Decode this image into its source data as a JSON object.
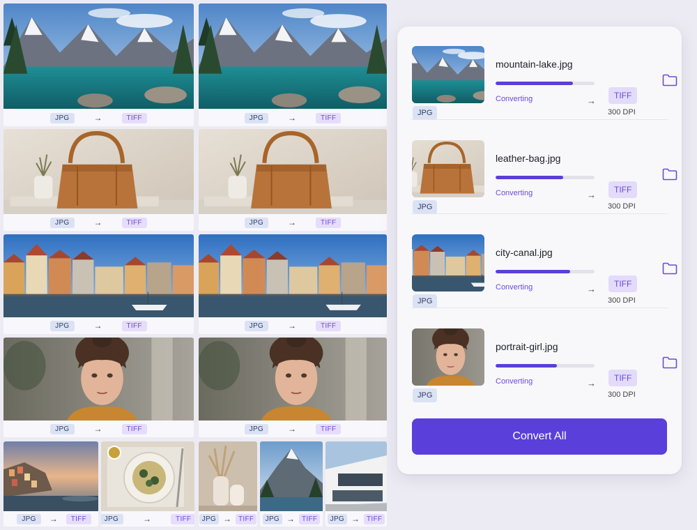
{
  "gallery": {
    "from_format": "JPG",
    "to_format": "TIFF",
    "arrow_glyph": "→",
    "image_names": [
      "mountain-lake",
      "leather-bag",
      "city-canal",
      "portrait-girl",
      "coastal-village",
      "pasta-plate",
      "vases",
      "mountain-peak",
      "modern-house"
    ]
  },
  "files": [
    {
      "name": "mountain-lake.jpg",
      "status": "Converting",
      "progress": 0.78,
      "source_format": "JPG",
      "target_format": "TIFF",
      "dpi": "300 DPI"
    },
    {
      "name": "leather-bag.jpg",
      "status": "Converting",
      "progress": 0.68,
      "source_format": "JPG",
      "target_format": "TIFF",
      "dpi": "300 DPI"
    },
    {
      "name": "city-canal.jpg",
      "status": "Converting",
      "progress": 0.75,
      "source_format": "JPG",
      "target_format": "TIFF",
      "dpi": "300 DPI"
    },
    {
      "name": "portrait-girl.jpg",
      "status": "Converting",
      "progress": 0.62,
      "source_format": "JPG",
      "target_format": "TIFF",
      "dpi": "300 DPI"
    }
  ],
  "convert_all_label": "Convert All",
  "colors": {
    "accent": "#5b3fdb",
    "jpg_badge": "#dbe2f4",
    "tiff_badge": "#e6dcfb"
  },
  "icons": {
    "row_action": "folder-icon",
    "arrow": "arrow-right-icon"
  }
}
